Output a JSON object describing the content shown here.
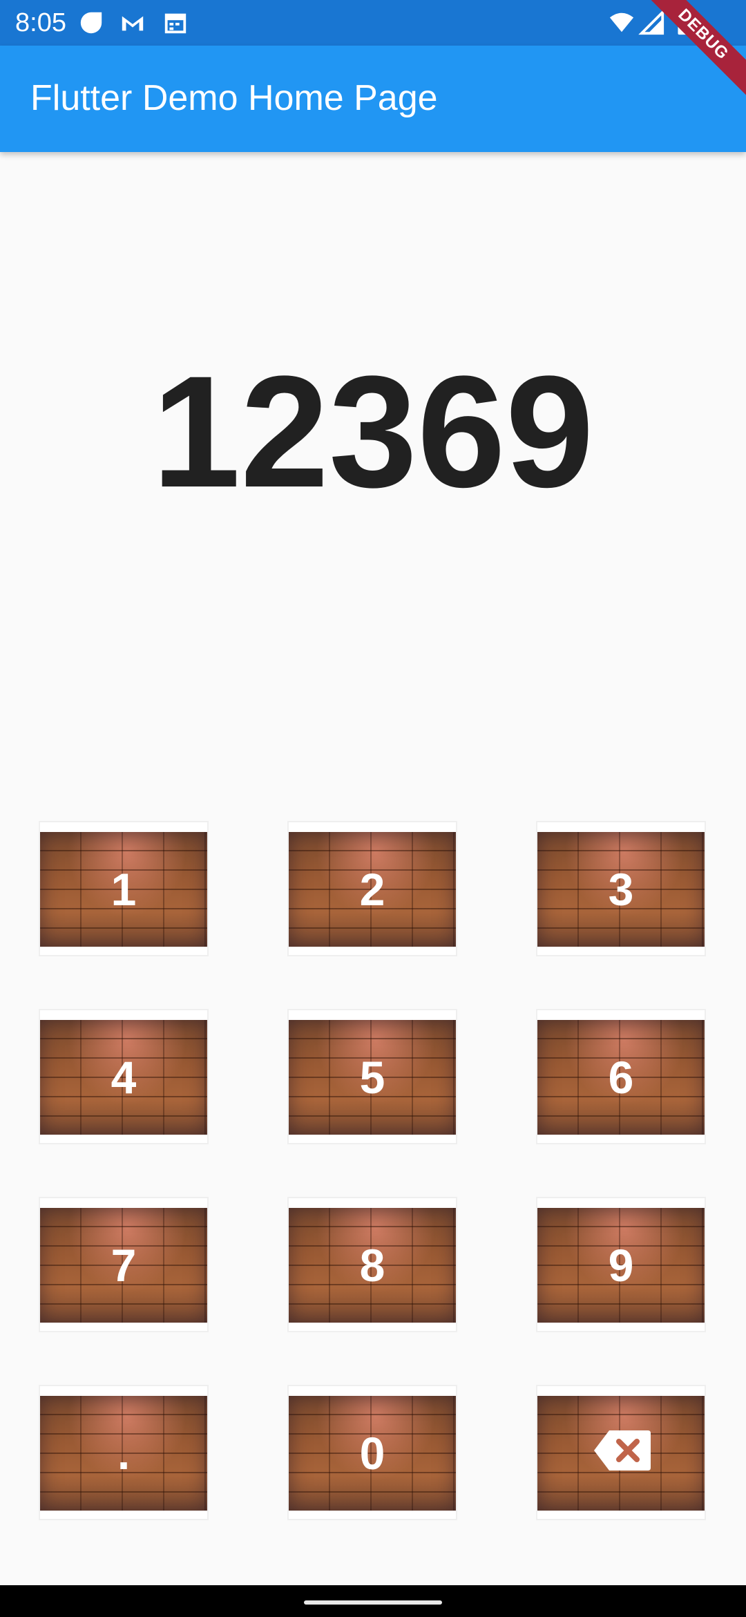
{
  "status_bar": {
    "time": "8:05",
    "left_icons": [
      "circle-notification-icon",
      "gmail-icon",
      "calendar-icon"
    ],
    "right_icons": [
      "wifi-icon",
      "cellular-signal-icon",
      "battery-icon"
    ]
  },
  "debug_banner": {
    "label": "DEBUG"
  },
  "app_bar": {
    "title": "Flutter Demo Home Page"
  },
  "display": {
    "value": "12369"
  },
  "keypad": {
    "keys": [
      {
        "label": "1"
      },
      {
        "label": "2"
      },
      {
        "label": "3"
      },
      {
        "label": "4"
      },
      {
        "label": "5"
      },
      {
        "label": "6"
      },
      {
        "label": "7"
      },
      {
        "label": "8"
      },
      {
        "label": "9"
      },
      {
        "label": "."
      },
      {
        "label": "0"
      },
      {
        "label": "",
        "icon": "backspace-icon"
      }
    ]
  },
  "colors": {
    "status_bar": "#1976d2",
    "app_bar": "#2196f3",
    "background": "#fafafa",
    "display_text": "#212121",
    "debug_banner": "#a8233b",
    "backspace_x": "#c0644a"
  }
}
